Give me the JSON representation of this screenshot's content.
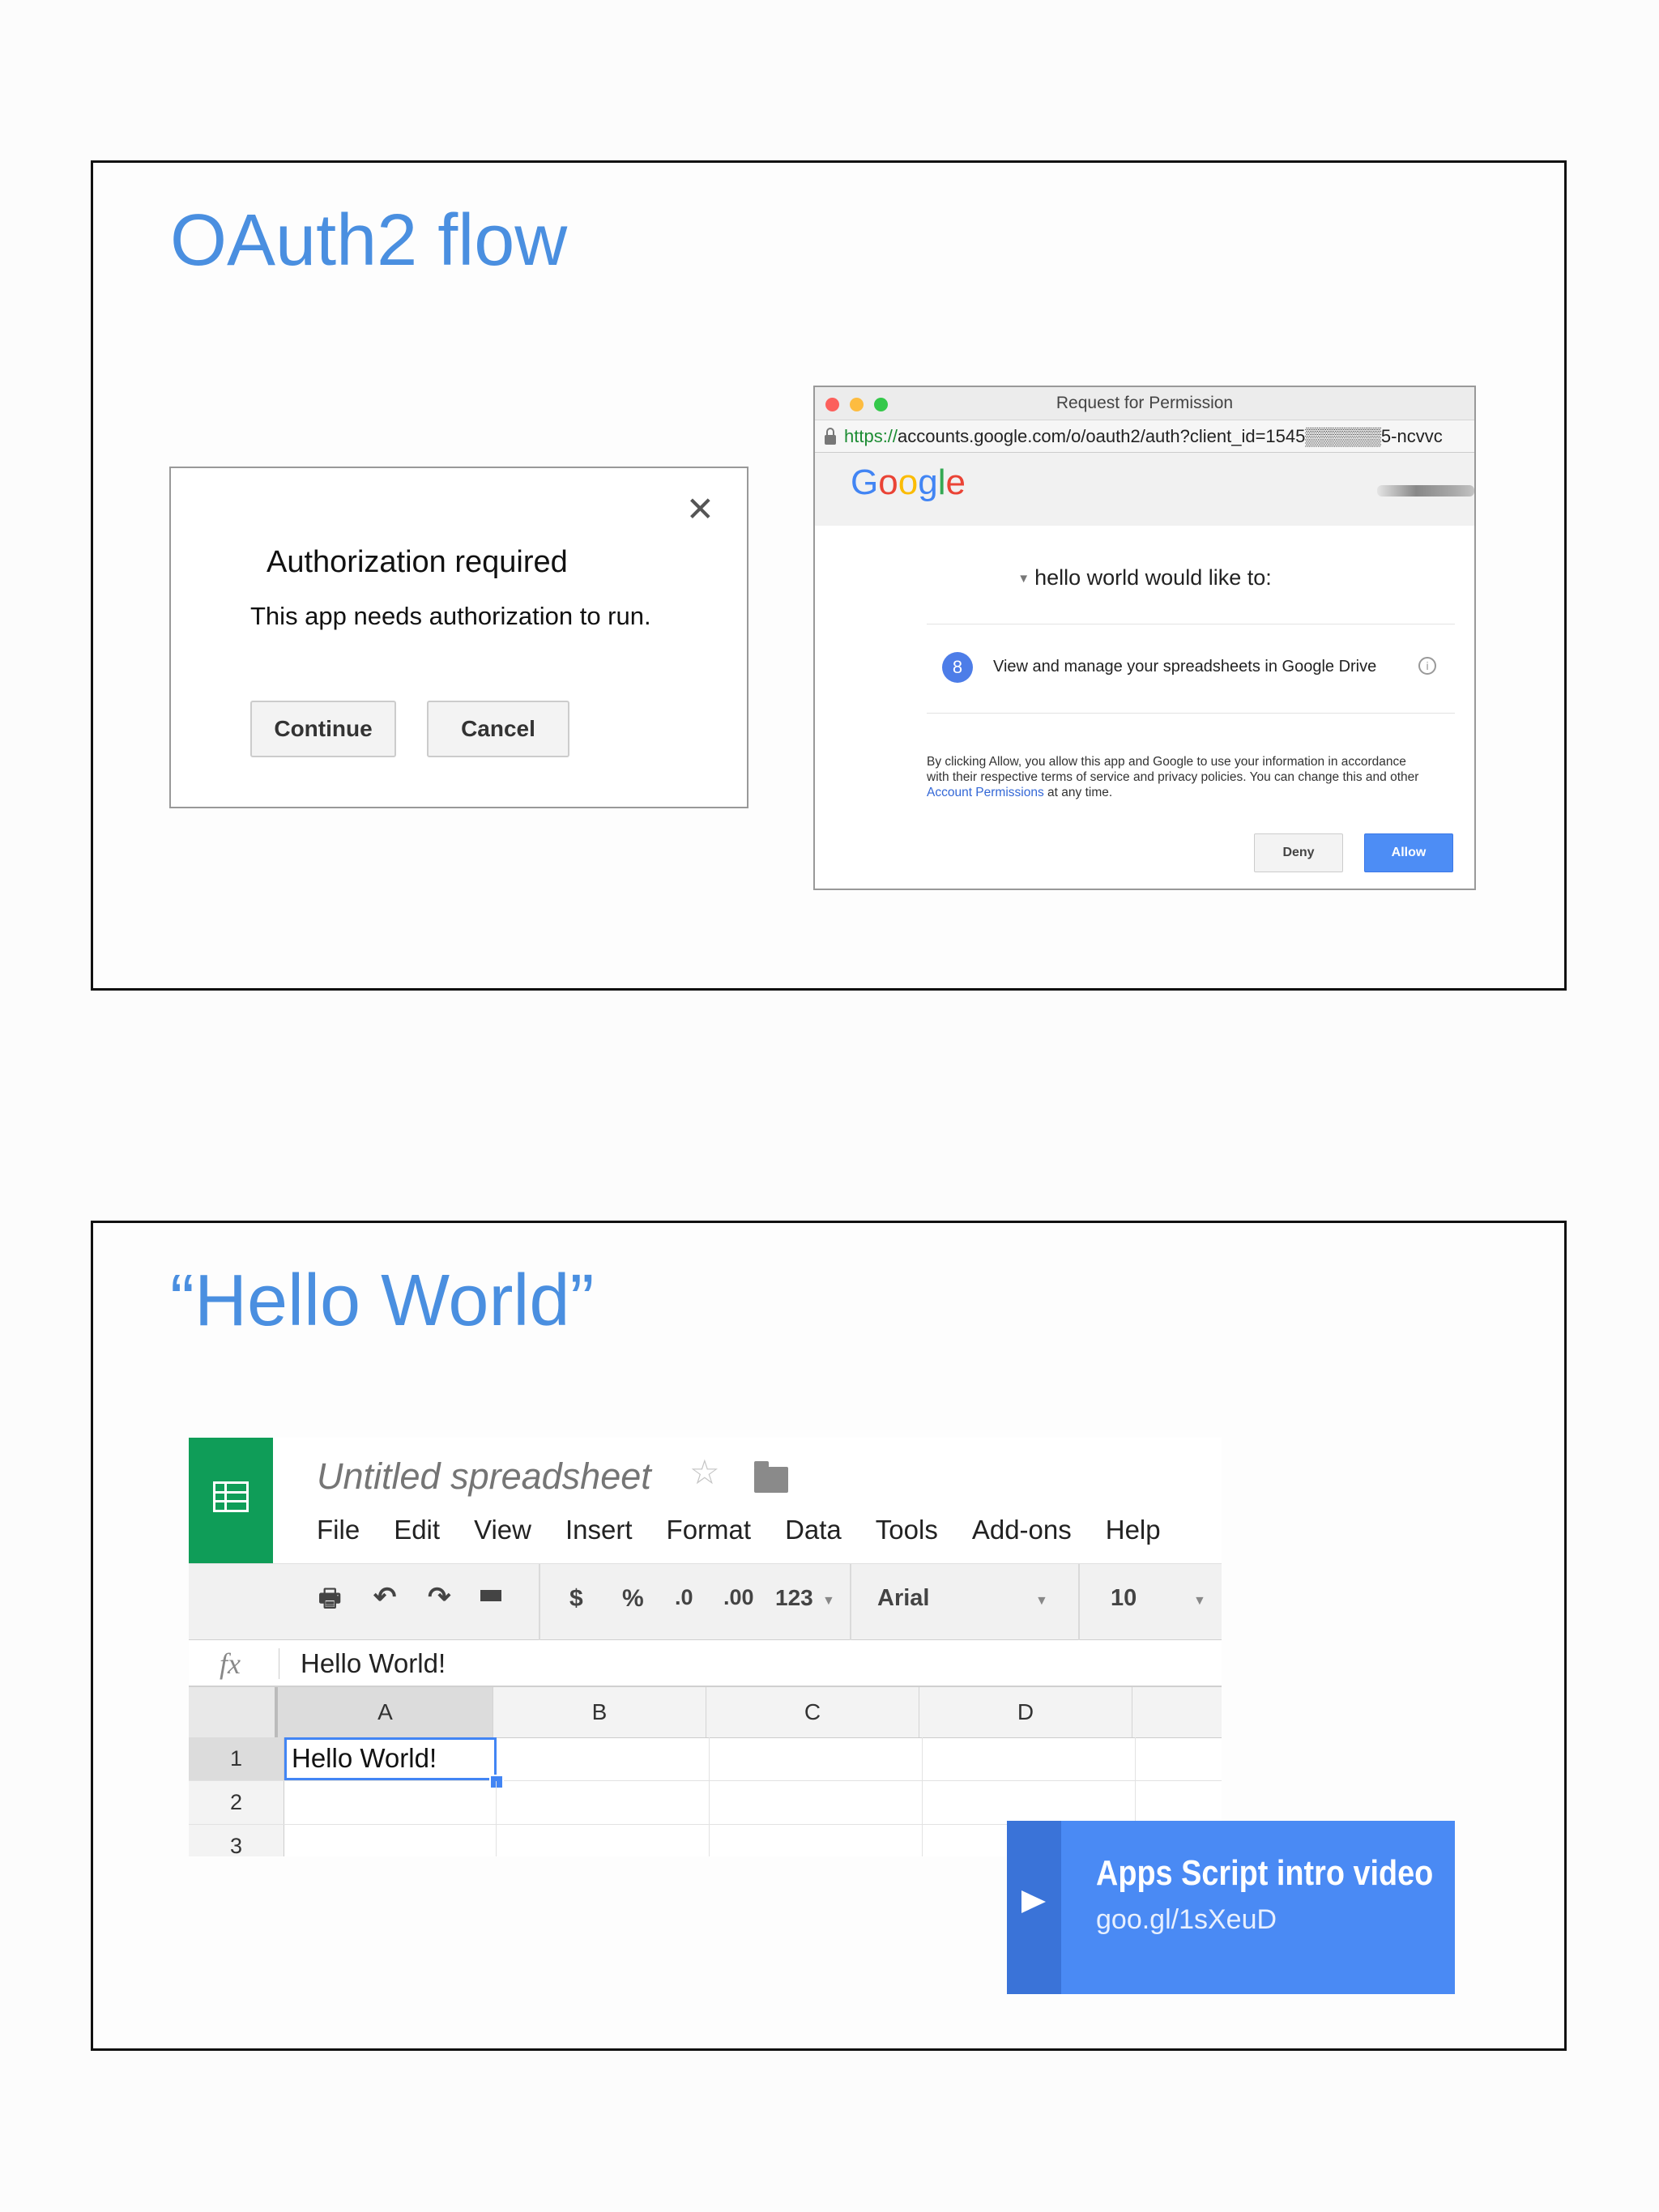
{
  "slide1": {
    "title": "OAuth2 flow",
    "auth_dialog": {
      "close_glyph": "✕",
      "heading": "Authorization required",
      "text": "This app needs authorization to run.",
      "continue_label": "Continue",
      "cancel_label": "Cancel"
    },
    "permission_window": {
      "window_title": "Request for Permission",
      "url_scheme": "https://",
      "url_rest": "accounts.google.com/o/oauth2/auth?client_id=1545▒▒▒▒▒▒5-ncvvc",
      "logo_letters": [
        "G",
        "o",
        "o",
        "g",
        "l",
        "e"
      ],
      "logo_colors": [
        "#4285f4",
        "#ea4335",
        "#fbbc05",
        "#4285f4",
        "#34a853",
        "#ea4335"
      ],
      "request_text": "hello world would like to:",
      "scope_icon_glyph": "8",
      "scope_text": "View and manage your spreadsheets in Google Drive",
      "legal_prefix": "By clicking Allow, you allow this app and Google to use your information in accordance with their respective terms of service and privacy policies. You can change this and other",
      "legal_link": "Account Permissions",
      "legal_suffix": "at any time.",
      "deny_label": "Deny",
      "allow_label": "Allow"
    }
  },
  "slide2": {
    "title": "“Hello World”",
    "spreadsheet": {
      "doc_title": "Untitled spreadsheet",
      "menu": [
        "File",
        "Edit",
        "View",
        "Insert",
        "Format",
        "Data",
        "Tools",
        "Add-ons",
        "Help"
      ],
      "toolbar": {
        "currency": "$",
        "percent": "%",
        "decrease_decimals": ".0",
        "increase_decimals": ".00",
        "number_format": "123",
        "font": "Arial",
        "font_size": "10"
      },
      "formula_icon": "fx",
      "formula_value": "Hello World!",
      "columns": [
        "A",
        "B",
        "C",
        "D"
      ],
      "rows": [
        "1",
        "2",
        "3"
      ],
      "cell_a1": "Hello World!"
    },
    "video_card": {
      "title": "Apps Script intro video",
      "url": "goo.gl/1sXeuD"
    }
  }
}
